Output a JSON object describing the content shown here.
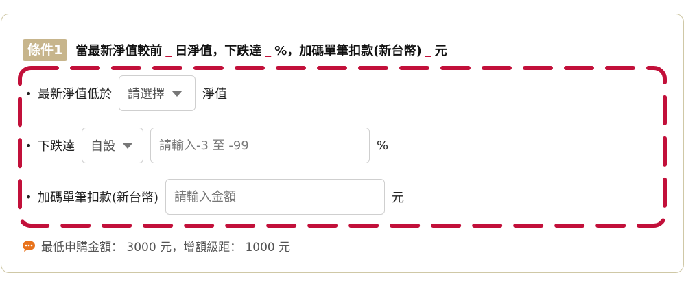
{
  "condition": {
    "badge": "條件1",
    "part1": "當最新淨值較前",
    "blank1": "_",
    "part2": "日淨值，下跌達",
    "blank2": "_",
    "part3": "%，加碼單筆扣款(新台幣)",
    "blank3": "_",
    "part4": "元"
  },
  "rows": [
    {
      "bullet": "•",
      "label": "最新淨值低於",
      "select": "請選擇",
      "suffix": "淨值"
    },
    {
      "bullet": "•",
      "label": "下跌達",
      "select": "自設",
      "input_placeholder": "請輸入-3 至 -99",
      "suffix": "%"
    },
    {
      "bullet": "•",
      "label": "加碼單筆扣款(新台幣)",
      "input_placeholder": "請輸入金額",
      "suffix": "元"
    }
  ],
  "note": "最低申購金額： 3000 元，增額級距： 1000 元",
  "colors": {
    "accent_dash": "#c2103a",
    "badge": "#c7b58c",
    "note_icon": "#e8731c"
  },
  "icons": {
    "note": "speech-bubble-icon",
    "select_caret": "caret-down-icon"
  }
}
